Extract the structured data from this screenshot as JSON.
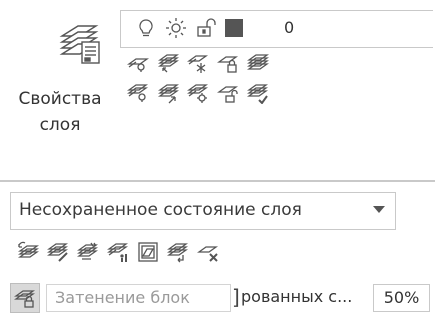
{
  "panel": {
    "title_line1": "Свойства",
    "title_line2": "слоя"
  },
  "layer_combo": {
    "current_layer_name": "0",
    "color_swatch": "#555555",
    "icons": [
      "lightbulb-icon",
      "sun-icon",
      "unlock-icon",
      "color-swatch"
    ]
  },
  "layer_states": {
    "selected": "Несохраненное состояние слоя"
  },
  "fade": {
    "label_left": "Затенение блок",
    "label_right": "рованных с...",
    "value": "50%"
  },
  "colors": {
    "icon_grey": "#555555",
    "border": "#c9c9c9",
    "fade_button_bg": "#d9d9d9",
    "disabled_text": "#9a9a9a"
  }
}
